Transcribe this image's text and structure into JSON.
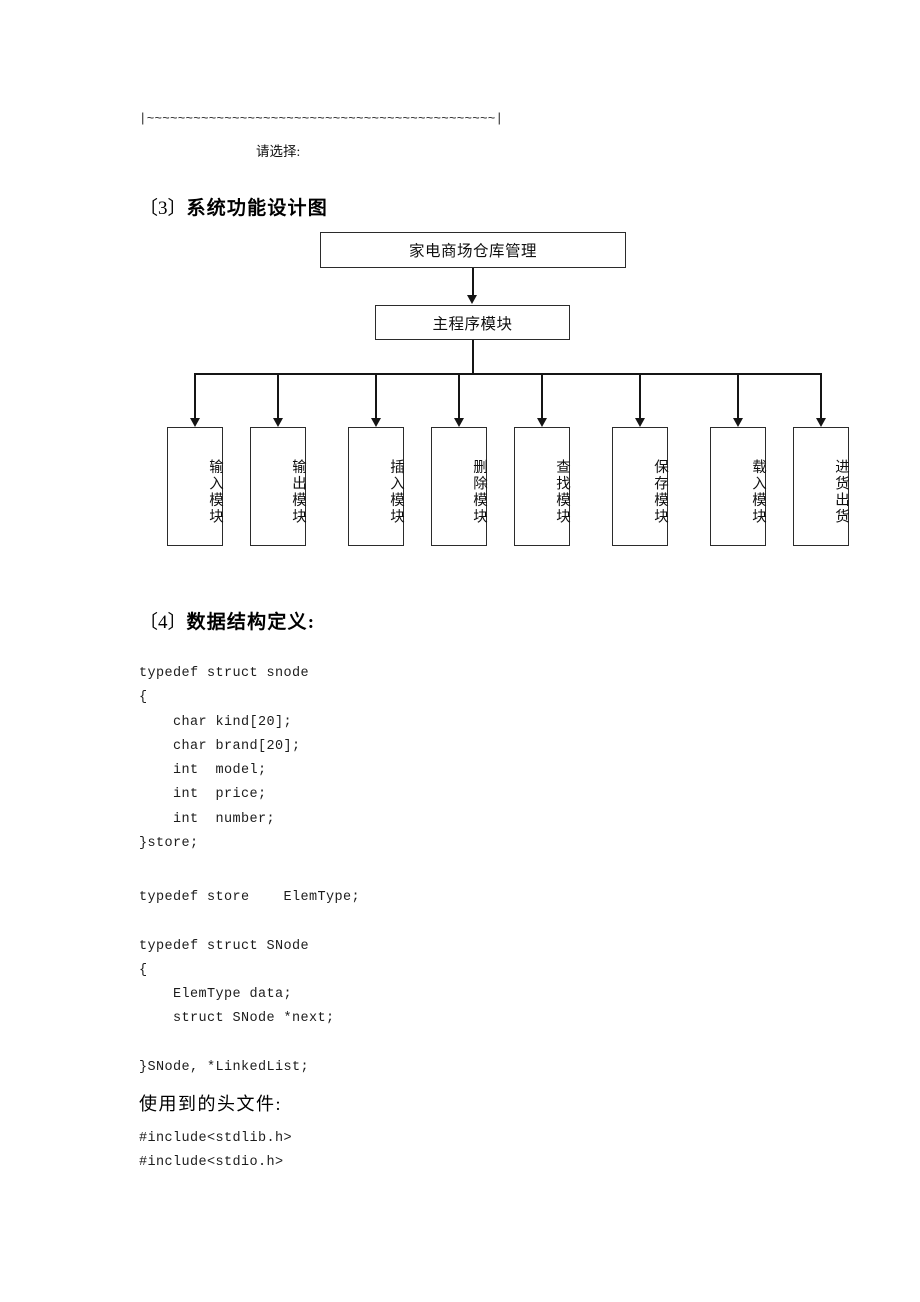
{
  "terminal": {
    "separator_line": "|~~~~~~~~~~~~~~~~~~~~~~~~~~~~~~~~~~~~~~~~~~~~~|",
    "prompt": "请选择:"
  },
  "sections": [
    {
      "number": "〔3〕",
      "title": "系统功能设计图"
    },
    {
      "number": "〔4〕",
      "title": "数据结构定义:"
    }
  ],
  "heading3": "〔3〕系统功能设计图",
  "heading3_bracket": "〔3〕",
  "heading3_text": "系统功能设计图",
  "heading4_bracket": "〔4〕",
  "heading4_text": "数据结构定义:",
  "subheading_headers": "使用到的头文件:",
  "diagram": {
    "root": "家电商场仓库管理",
    "main": "主程序模块",
    "modules": [
      "输入模块",
      "输出模块",
      "插入模块",
      "删除模块",
      "查找模块",
      "保存模块",
      "载入模块",
      "进货出货"
    ]
  },
  "code": {
    "block1": "typedef struct snode\n{\n    char kind[20];\n    char brand[20];\n    int  model;\n    int  price;\n    int  number;\n}store;",
    "block2": "typedef store    ElemType;\n\ntypedef struct SNode\n{\n    ElemType data;\n    struct SNode *next;\n\n}SNode, *LinkedList;",
    "block3": "#include<stdlib.h>\n#include<stdio.h>"
  },
  "colors": {
    "text": "#000000",
    "line": "#151515",
    "box_border": "#2b2b2b",
    "page_bg": "#ffffff"
  }
}
